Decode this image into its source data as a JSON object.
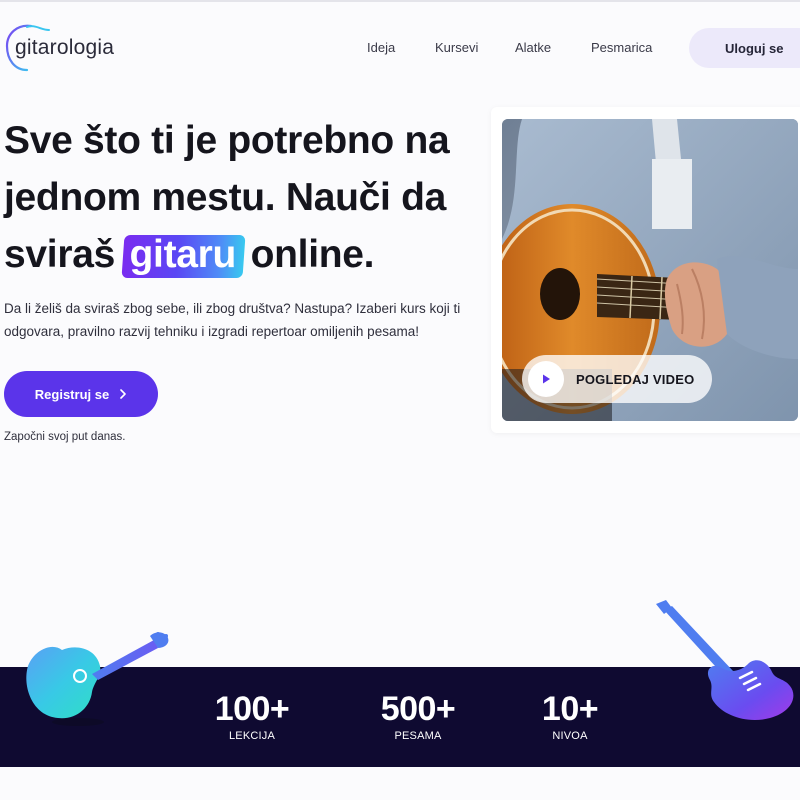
{
  "brand": {
    "name": "gitarologia"
  },
  "nav": {
    "items": [
      "Ideja",
      "Kursevi",
      "Alatke",
      "Pesmarica"
    ],
    "login_label": "Uloguj se"
  },
  "hero": {
    "title_line1": "Sve što ti je potrebno na",
    "title_line2": "jednom mestu. Nauči da",
    "title_line3_before": "sviraš",
    "title_highlight": "gitaru",
    "title_line3_after": "online.",
    "subtitle": "Da li želiš da sviraš zbog sebe, ili zbog društva? Nastupa? Izaberi kurs koji ti odgovara, pravilno razvij tehniku i izgradi repertoar omiljenih pesama!",
    "cta_label": "Registruj se",
    "cta_icon": "chevron-right-icon",
    "cta_note": "Započni svoj put danas."
  },
  "video": {
    "button_label": "POGLEDAJ VIDEO",
    "button_icon": "play-icon"
  },
  "stats": [
    {
      "value": "100+",
      "label": "LEKCIJA"
    },
    {
      "value": "500+",
      "label": "PESAMA"
    },
    {
      "value": "10+",
      "label": "NIVOA"
    }
  ],
  "colors": {
    "accent": "#5b34ea",
    "stats_band": "#0f0a31",
    "login_bg": "#ece9fa",
    "background": "#fbfbfd"
  }
}
